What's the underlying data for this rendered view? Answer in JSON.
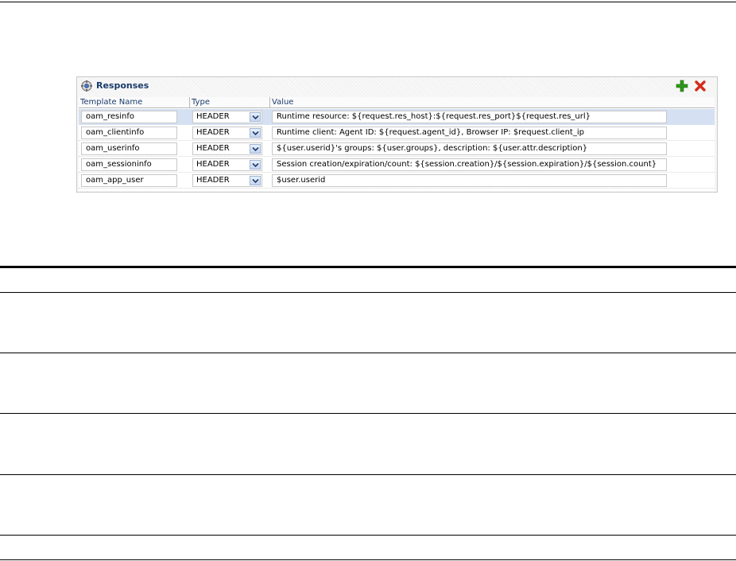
{
  "panel": {
    "title": "Responses",
    "icon": "gear-globe-icon",
    "actions": {
      "add_icon": "add-plus-icon",
      "delete_icon": "delete-x-icon"
    }
  },
  "columns": [
    "Template Name",
    "Type",
    "Value"
  ],
  "rows": [
    {
      "name": "oam_resinfo",
      "type": "HEADER",
      "value": "Runtime resource: ${request.res_host}:${request.res_port}${request.res_url}"
    },
    {
      "name": "oam_clientinfo",
      "type": "HEADER",
      "value": "Runtime client: Agent ID: ${request.agent_id}, Browser IP: $request.client_ip"
    },
    {
      "name": "oam_userinfo",
      "type": "HEADER",
      "value": "${user.userid}'s groups: ${user.groups}, description: ${user.attr.description}"
    },
    {
      "name": "oam_sessioninfo",
      "type": "HEADER",
      "value": "Session creation/expiration/count: ${session.creation}/${session.expiration}/${session.count}"
    },
    {
      "name": "oam_app_user",
      "type": "HEADER",
      "value": "$user.userid"
    }
  ],
  "colors": {
    "accent": "#1b3b6b",
    "selected_row": "#d5e1f2",
    "add": "#2e9a1a",
    "delete": "#d42a1a"
  }
}
